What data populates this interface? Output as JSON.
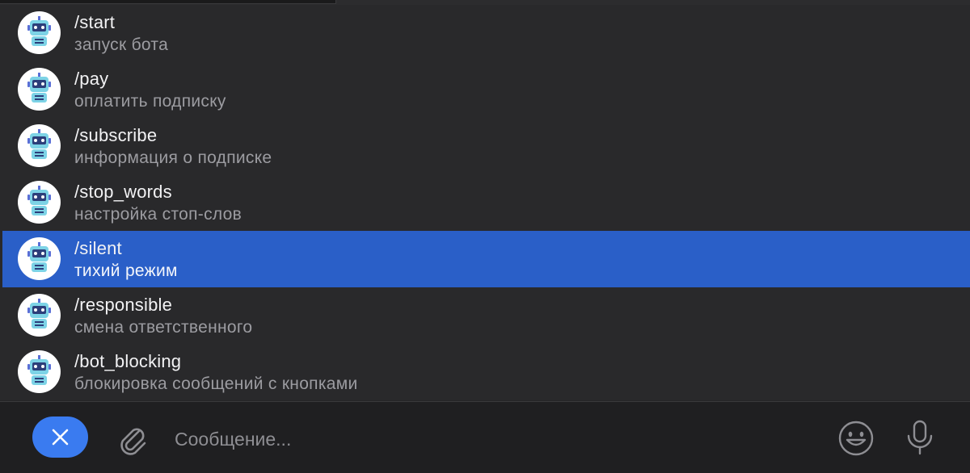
{
  "commands": [
    {
      "name": "/start",
      "description": "запуск бота",
      "icon": "robot-avatar-icon"
    },
    {
      "name": "/pay",
      "description": "оплатить подписку",
      "icon": "robot-avatar-icon"
    },
    {
      "name": "/subscribe",
      "description": "информация о подписке",
      "icon": "robot-avatar-icon"
    },
    {
      "name": "/stop_words",
      "description": "настройка стоп-слов",
      "icon": "robot-avatar-icon"
    },
    {
      "name": "/silent",
      "description": "тихий режим",
      "icon": "robot-avatar-icon",
      "selected": true
    },
    {
      "name": "/responsible",
      "description": "смена ответственного",
      "icon": "robot-avatar-icon"
    },
    {
      "name": "/bot_blocking",
      "description": "блокировка сообщений с кнопками",
      "icon": "robot-avatar-icon"
    }
  ],
  "composer": {
    "placeholder": "Сообщение...",
    "close_icon": "close-icon",
    "attach_icon": "paperclip-icon",
    "emoji_icon": "emoji-icon",
    "mic_icon": "microphone-icon"
  },
  "colors": {
    "selected_row": "#2a5fc8",
    "close_button": "#3a7bf0",
    "background": "#29292b"
  }
}
